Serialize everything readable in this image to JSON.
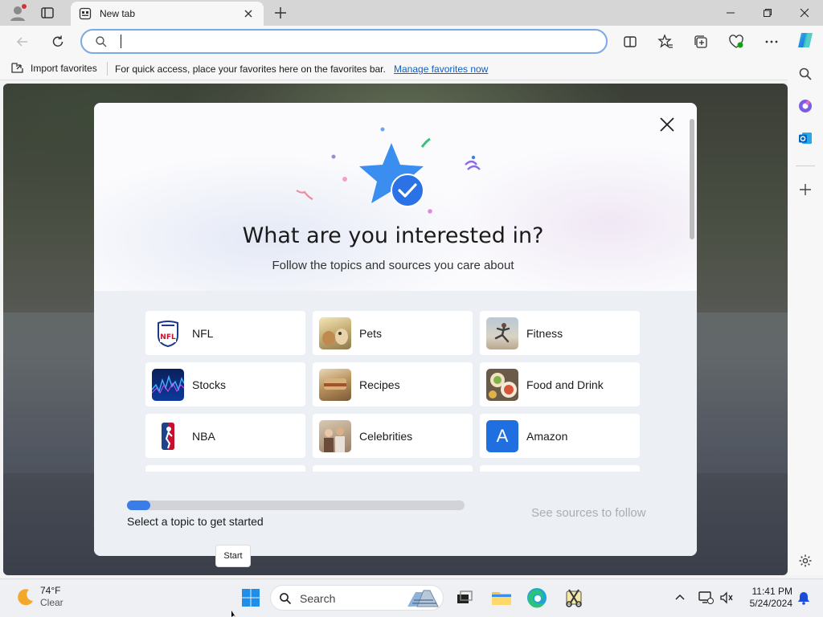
{
  "browser": {
    "tab_title": "New tab",
    "address_placeholder": "",
    "favorites_bar": {
      "import_label": "Import favorites",
      "message": "For quick access, place your favorites here on the favorites bar.",
      "manage_link": "Manage favorites now"
    }
  },
  "modal": {
    "title": "What are you interested in?",
    "subtitle": "Follow the topics and sources you care about",
    "topics": [
      {
        "label": "NFL",
        "icon": "nfl-logo-icon"
      },
      {
        "label": "Pets",
        "icon": "pets-photo"
      },
      {
        "label": "Fitness",
        "icon": "fitness-photo"
      },
      {
        "label": "Stocks",
        "icon": "stocks-photo"
      },
      {
        "label": "Recipes",
        "icon": "recipes-photo"
      },
      {
        "label": "Food and Drink",
        "icon": "food-photo"
      },
      {
        "label": "NBA",
        "icon": "nba-logo-icon"
      },
      {
        "label": "Celebrities",
        "icon": "celebrities-photo"
      },
      {
        "label": "Amazon",
        "icon": "amazon-icon",
        "letter": "A"
      }
    ],
    "progress": {
      "fraction": 0.07,
      "text": "Select a topic to get started"
    },
    "see_sources": "See sources to follow"
  },
  "tooltip": {
    "text": "Start"
  },
  "taskbar": {
    "weather": {
      "temp": "74°F",
      "condition": "Clear"
    },
    "search_label": "Search",
    "clock": {
      "time": "11:41 PM",
      "date": "5/24/2024"
    }
  },
  "colors": {
    "accent": "#3b7de8",
    "amazon": "#1f6fe0"
  }
}
